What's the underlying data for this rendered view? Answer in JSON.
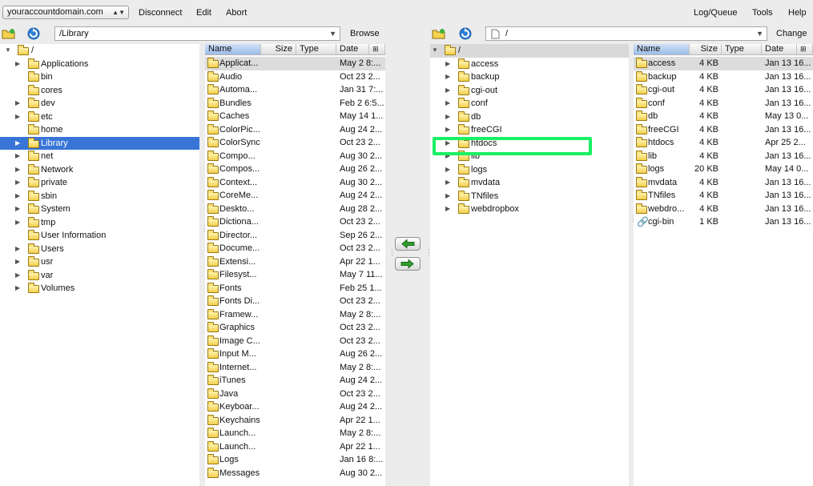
{
  "topbar": {
    "host": "youraccountdomain.com",
    "left_menu": [
      "Disconnect",
      "Edit",
      "Abort"
    ],
    "right_menu": [
      "Log/Queue",
      "Tools",
      "Help"
    ]
  },
  "local": {
    "path": "/Library",
    "action": "Browse",
    "tree_root": "/",
    "tree": [
      {
        "label": "Applications",
        "expand": true
      },
      {
        "label": "bin",
        "expand": false
      },
      {
        "label": "cores",
        "expand": false
      },
      {
        "label": "dev",
        "expand": true
      },
      {
        "label": "etc",
        "expand": true
      },
      {
        "label": "home",
        "expand": false
      },
      {
        "label": "Library",
        "expand": true,
        "selected": true
      },
      {
        "label": "net",
        "expand": true
      },
      {
        "label": "Network",
        "expand": true
      },
      {
        "label": "private",
        "expand": true
      },
      {
        "label": "sbin",
        "expand": true
      },
      {
        "label": "System",
        "expand": true
      },
      {
        "label": "tmp",
        "expand": true
      },
      {
        "label": "User Information",
        "expand": false
      },
      {
        "label": "Users",
        "expand": true
      },
      {
        "label": "usr",
        "expand": true
      },
      {
        "label": "var",
        "expand": true
      },
      {
        "label": "Volumes",
        "expand": true
      }
    ],
    "columns": [
      "Name",
      "Size",
      "Type",
      "Date"
    ],
    "files": [
      {
        "name": "Applicat...",
        "size": "",
        "date": "May 2 8:..."
      },
      {
        "name": "Audio",
        "size": "",
        "date": "Oct 23 2..."
      },
      {
        "name": "Automa...",
        "size": "",
        "date": "Jan 31 7:..."
      },
      {
        "name": "Bundles",
        "size": "",
        "date": "Feb 2 6:5..."
      },
      {
        "name": "Caches",
        "size": "",
        "date": "May 14 1..."
      },
      {
        "name": "ColorPic...",
        "size": "",
        "date": "Aug 24 2..."
      },
      {
        "name": "ColorSync",
        "size": "",
        "date": "Oct 23 2..."
      },
      {
        "name": "Compo...",
        "size": "",
        "date": "Aug 30 2..."
      },
      {
        "name": "Compos...",
        "size": "",
        "date": "Aug 26 2..."
      },
      {
        "name": "Context...",
        "size": "",
        "date": "Aug 30 2..."
      },
      {
        "name": "CoreMe...",
        "size": "",
        "date": "Aug 24 2..."
      },
      {
        "name": "Deskto...",
        "size": "",
        "date": "Aug 28 2..."
      },
      {
        "name": "Dictiona...",
        "size": "",
        "date": "Oct 23 2..."
      },
      {
        "name": "Director...",
        "size": "",
        "date": "Sep 26 2..."
      },
      {
        "name": "Docume...",
        "size": "",
        "date": "Oct 23 2..."
      },
      {
        "name": "Extensi...",
        "size": "",
        "date": "Apr 22 1..."
      },
      {
        "name": "Filesyst...",
        "size": "",
        "date": "May 7 11..."
      },
      {
        "name": "Fonts",
        "size": "",
        "date": "Feb 25 1..."
      },
      {
        "name": "Fonts Di...",
        "size": "",
        "date": "Oct 23 2..."
      },
      {
        "name": "Framew...",
        "size": "",
        "date": "May 2 8:..."
      },
      {
        "name": "Graphics",
        "size": "",
        "date": "Oct 23 2..."
      },
      {
        "name": "Image C...",
        "size": "",
        "date": "Oct 23 2..."
      },
      {
        "name": "Input M...",
        "size": "",
        "date": "Aug 26 2..."
      },
      {
        "name": "Internet...",
        "size": "",
        "date": "May 2 8:..."
      },
      {
        "name": "iTunes",
        "size": "",
        "date": "Aug 24 2..."
      },
      {
        "name": "Java",
        "size": "",
        "date": "Oct 23 2..."
      },
      {
        "name": "Keyboar...",
        "size": "",
        "date": "Aug 24 2..."
      },
      {
        "name": "Keychains",
        "size": "",
        "date": "Apr 22 1..."
      },
      {
        "name": "Launch...",
        "size": "",
        "date": "May 2 8:..."
      },
      {
        "name": "Launch...",
        "size": "",
        "date": "Apr 22 1..."
      },
      {
        "name": "Logs",
        "size": "",
        "date": "Jan 16 8:..."
      },
      {
        "name": "Messages",
        "size": "",
        "date": "Aug 30 2..."
      }
    ]
  },
  "remote": {
    "path": "/",
    "action": "Change",
    "tree_root": "/",
    "tree": [
      {
        "label": "access"
      },
      {
        "label": "backup"
      },
      {
        "label": "cgi-out"
      },
      {
        "label": "conf"
      },
      {
        "label": "db"
      },
      {
        "label": "freeCGI"
      },
      {
        "label": "htdocs"
      },
      {
        "label": "lib"
      },
      {
        "label": "logs"
      },
      {
        "label": "mvdata"
      },
      {
        "label": "TNfiles"
      },
      {
        "label": "webdropbox"
      }
    ],
    "columns": [
      "Name",
      "Size",
      "Type",
      "Date"
    ],
    "files": [
      {
        "name": "access",
        "size": "4 KB",
        "date": "Jan 13 16..."
      },
      {
        "name": "backup",
        "size": "4 KB",
        "date": "Jan 13 16..."
      },
      {
        "name": "cgi-out",
        "size": "4 KB",
        "date": "Jan 13 16..."
      },
      {
        "name": "conf",
        "size": "4 KB",
        "date": "Jan 13 16..."
      },
      {
        "name": "db",
        "size": "4 KB",
        "date": "May 13 0..."
      },
      {
        "name": "freeCGI",
        "size": "4 KB",
        "date": "Jan 13 16..."
      },
      {
        "name": "htdocs",
        "size": "4 KB",
        "date": "Apr 25 2..."
      },
      {
        "name": "lib",
        "size": "4 KB",
        "date": "Jan 13 16..."
      },
      {
        "name": "logs",
        "size": "20 KB",
        "date": "May 14 0..."
      },
      {
        "name": "mvdata",
        "size": "4 KB",
        "date": "Jan 13 16..."
      },
      {
        "name": "TNfiles",
        "size": "4 KB",
        "date": "Jan 13 16..."
      },
      {
        "name": "webdro...",
        "size": "4 KB",
        "date": "Jan 13 16..."
      },
      {
        "name": "cgi-bin",
        "size": "1 KB",
        "date": "Jan 13 16...",
        "link": true
      }
    ]
  },
  "colors": {
    "selection": "#3875d7",
    "highlight_box": "#19f063",
    "arrow_green": "#2f9e2f"
  }
}
